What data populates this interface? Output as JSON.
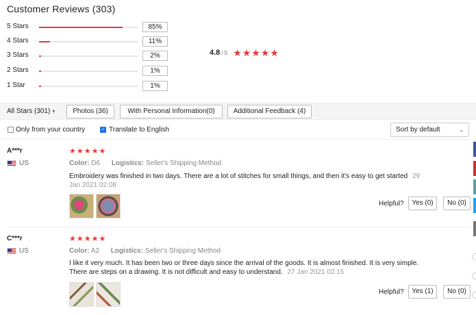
{
  "header": {
    "title": "Customer Reviews (303)"
  },
  "distribution": [
    {
      "label": "5 Stars",
      "fraction": 0.85,
      "percent": "85%"
    },
    {
      "label": "4 Stars",
      "fraction": 0.11,
      "percent": "11%"
    },
    {
      "label": "3 Stars",
      "fraction": 0.02,
      "percent": "2%"
    },
    {
      "label": "2 Stars",
      "fraction": 0.01,
      "percent": "1%"
    },
    {
      "label": "1 Star",
      "fraction": 0.01,
      "percent": "1%"
    }
  ],
  "summary": {
    "average": "4.8",
    "out_of": "/ 5",
    "stars": "★★★★★"
  },
  "filters": {
    "all_stars": "All Stars (301)",
    "all_stars_icon": "chevron-down-icon",
    "buttons": [
      "Photos (36)",
      "With Personal Information(0)",
      "Additional Feedback (4)"
    ]
  },
  "options": {
    "only_country": {
      "label": "Only from your country",
      "checked": false
    },
    "translate": {
      "label": "Translate to English",
      "checked": true
    },
    "sort": {
      "value": "Sort by default",
      "icon": "chevron-down-icon"
    }
  },
  "reviews": [
    {
      "name": "A***r",
      "country": "US",
      "stars": "★★★★★",
      "color_label": "Color:",
      "color_value": "D6",
      "logistics_label": "Logistics:",
      "logistics_value": "Seller's Shipping Method",
      "text": "Embroidery was finished in two days. There are a lot of stitches for small things, and then it's easy to get started",
      "date": "29 Jan 2021 02:08",
      "helpful_label": "Helpful?",
      "yes": "Yes (0)",
      "no": "No (0)"
    },
    {
      "name": "C***r",
      "country": "US",
      "stars": "★★★★★",
      "color_label": "Color:",
      "color_value": "A2",
      "logistics_label": "Logistics:",
      "logistics_value": "Seller's Shipping Method",
      "text": "I like it very much. It has been two or three days since the arrival of the goods. It is almost finished. It is very simple. There are steps on a drawing. It is not difficult and easy to understand.",
      "date": "27 Jan 2021 02:15",
      "helpful_label": "Helpful?",
      "yes": "Yes (1)",
      "no": "No (0)"
    }
  ],
  "colors": {
    "accent": "#e4393c",
    "check": "#1a73e8",
    "edge_tabs": [
      "#3b5998",
      "#c0392b",
      "#5e9ea0",
      "#1da1f2",
      "#777777"
    ]
  }
}
